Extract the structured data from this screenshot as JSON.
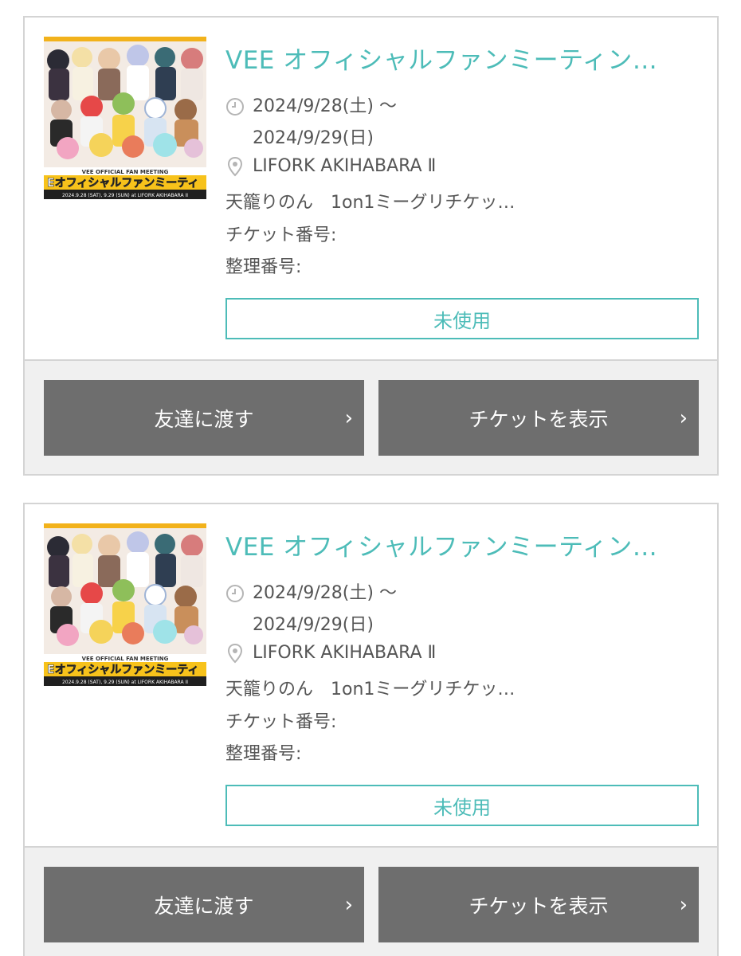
{
  "tickets": [
    {
      "title": "VEE オフィシャルファンミーティン…",
      "date_start": "2024/9/28(土) ～",
      "date_end": "2024/9/29(日)",
      "venue": "LIFORK AKIHABARA Ⅱ",
      "product": "天籠りのん　1on1ミーグリチケッ…",
      "ticket_number_label": "チケット番号:",
      "ticket_number": "",
      "entry_number_label": "整理番号:",
      "entry_number": "",
      "status": "未使用",
      "transfer_label": "友達に渡す",
      "show_ticket_label": "チケットを表示",
      "thumb": {
        "banner_top": "VEE OFFICIAL FAN MEETING",
        "banner_main": "Eオフィシャルファンミーティ",
        "banner_date": "2024.9.28 (SAT), 9.29 (SUN)  at LIFORK AKIHABARA II"
      }
    },
    {
      "title": "VEE オフィシャルファンミーティン…",
      "date_start": "2024/9/28(土) ～",
      "date_end": "2024/9/29(日)",
      "venue": "LIFORK AKIHABARA Ⅱ",
      "product": "天籠りのん　1on1ミーグリチケッ…",
      "ticket_number_label": "チケット番号:",
      "ticket_number": "",
      "entry_number_label": "整理番号:",
      "entry_number": "",
      "status": "未使用",
      "transfer_label": "友達に渡す",
      "show_ticket_label": "チケットを表示",
      "thumb": {
        "banner_top": "VEE OFFICIAL FAN MEETING",
        "banner_main": "Eオフィシャルファンミーティ",
        "banner_date": "2024.9.28 (SAT), 9.29 (SUN)  at LIFORK AKIHABARA II"
      }
    }
  ],
  "colors": {
    "accent": "#4dbcb8",
    "button_gray": "#6e6e6e",
    "border": "#d4d4d4",
    "actions_bg": "#f0f0f0"
  },
  "icons": {
    "time": "clock-icon",
    "location": "map-pin-icon",
    "chevron": "chevron-right-icon"
  }
}
